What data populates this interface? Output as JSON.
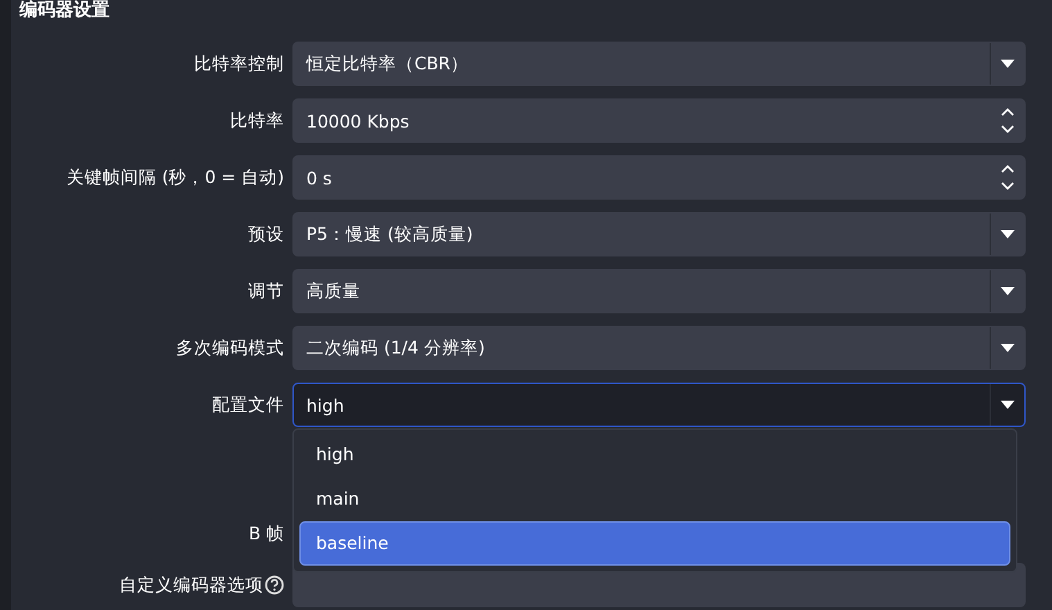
{
  "section_title": "编码器设置",
  "rows": [
    {
      "kind": "select",
      "label": "比特率控制",
      "value": "恒定比特率（CBR）",
      "focused": false
    },
    {
      "kind": "spin",
      "label": "比特率",
      "value": "10000 Kbps",
      "focused": false
    },
    {
      "kind": "spin",
      "label": "关键帧间隔 (秒，0 = 自动)",
      "value": "0 s",
      "focused": false
    },
    {
      "kind": "select",
      "label": "预设",
      "value": "P5：慢速 (较高质量)",
      "focused": false
    },
    {
      "kind": "select",
      "label": "调节",
      "value": "高质量",
      "focused": false
    },
    {
      "kind": "select",
      "label": "多次编码模式",
      "value": "二次编码 (1/4 分辨率)",
      "focused": false
    },
    {
      "kind": "select",
      "label": "配置文件",
      "value": "high",
      "focused": true
    },
    {
      "kind": "covered",
      "label": "B 帧"
    },
    {
      "kind": "text",
      "label": "自定义编码器选项",
      "help": true
    }
  ],
  "dropdown": {
    "options": [
      {
        "label": "high",
        "selected": false
      },
      {
        "label": "main",
        "selected": false
      },
      {
        "label": "baseline",
        "selected": true
      }
    ]
  }
}
